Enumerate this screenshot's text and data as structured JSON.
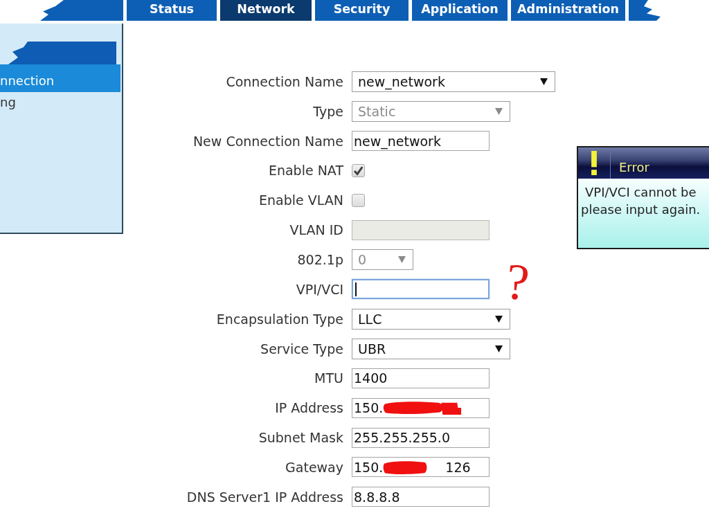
{
  "tabs": [
    {
      "label": "Status",
      "selected": false
    },
    {
      "label": "Network",
      "selected": true
    },
    {
      "label": "Security",
      "selected": false
    },
    {
      "label": "Application",
      "selected": false
    },
    {
      "label": "Administration",
      "selected": false
    }
  ],
  "sidebar": {
    "items": [
      {
        "label": "nnection",
        "selected": true
      },
      {
        "label": "ng",
        "selected": false
      }
    ]
  },
  "form": {
    "fields": [
      {
        "label": "Connection Name",
        "kind": "select",
        "value": "new_network",
        "disabled": false,
        "focused": false
      },
      {
        "label": "Type",
        "kind": "select",
        "value": "Static",
        "disabled": true,
        "focused": false
      },
      {
        "label": "New Connection Name",
        "kind": "text",
        "value": "new_network",
        "disabled": false,
        "focused": false
      },
      {
        "label": "Enable NAT",
        "kind": "checkbox",
        "checked": true,
        "disabled": false
      },
      {
        "label": "Enable VLAN",
        "kind": "checkbox",
        "checked": false,
        "disabled": false
      },
      {
        "label": "VLAN ID",
        "kind": "text",
        "disabled": true,
        "focused": false
      },
      {
        "label": "802.1p",
        "kind": "select",
        "value": "0",
        "disabled": true,
        "focused": false
      },
      {
        "label": "VPI/VCI",
        "kind": "text",
        "disabled": false,
        "focused": true
      },
      {
        "label": "Encapsulation Type",
        "kind": "select",
        "value": "LLC",
        "disabled": false,
        "focused": false
      },
      {
        "label": "Service Type",
        "kind": "select",
        "value": "UBR",
        "disabled": false,
        "focused": false
      },
      {
        "label": "MTU",
        "kind": "text",
        "value": "1400",
        "disabled": false,
        "focused": false
      },
      {
        "label": "IP Address",
        "kind": "text",
        "value": "150.",
        "redacted": true,
        "disabled": false,
        "focused": false
      },
      {
        "label": "Subnet Mask",
        "kind": "text",
        "value": "255.255.255.0",
        "disabled": false,
        "focused": false
      },
      {
        "label": "Gateway",
        "kind": "text",
        "value": "150.",
        "redacted": true,
        "value_after": "126",
        "disabled": false,
        "focused": false
      },
      {
        "label": "DNS Server1 IP Address",
        "kind": "text",
        "value": "8.8.8.8",
        "disabled": false,
        "focused": false
      }
    ]
  },
  "handwritten_note": "?",
  "error_dialog": {
    "title": "Error",
    "message_lines": [
      "VPI/VCI cannot be",
      "please input again."
    ]
  }
}
